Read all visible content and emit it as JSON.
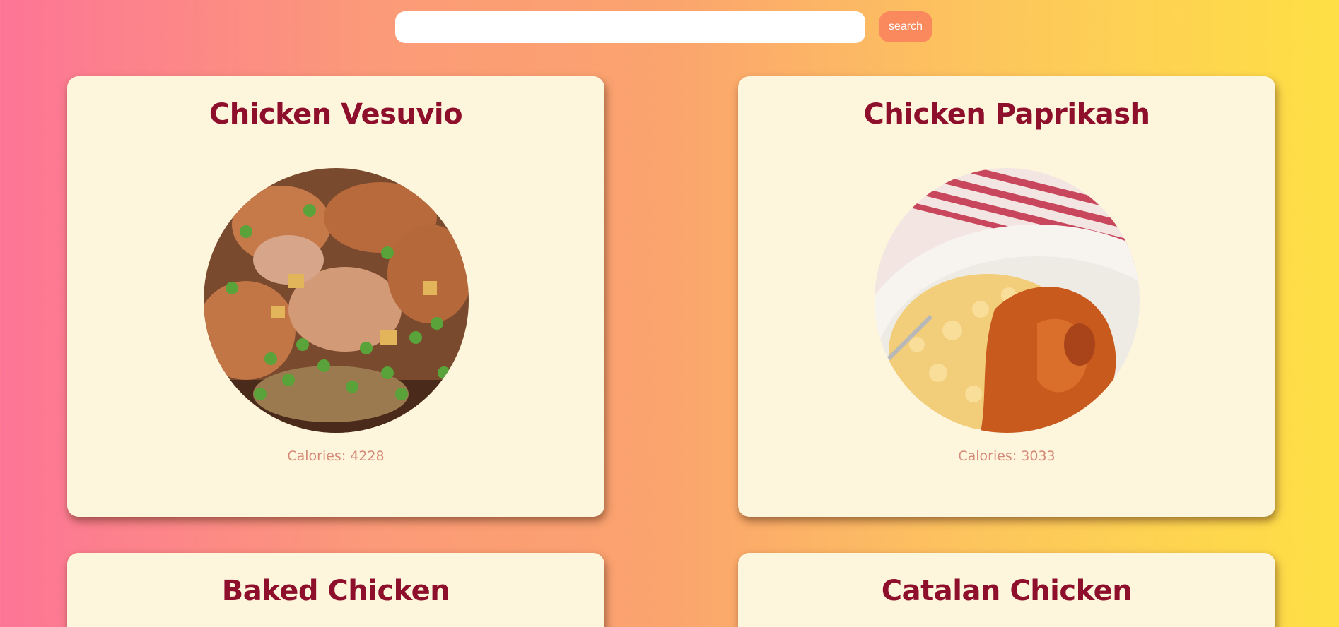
{
  "search": {
    "value": "",
    "placeholder": "",
    "button_label": "search"
  },
  "colors": {
    "gradient_start": "#fd7596",
    "gradient_end": "#fee045",
    "card_background": "#fef6dc",
    "title_color": "#8e0f2c",
    "calories_color": "#d58a78",
    "button_color": "#fa8a5d"
  },
  "recipes": [
    {
      "title": "Chicken Vesuvio",
      "calories": "Calories: 4228",
      "image": "chicken-vesuvio-photo"
    },
    {
      "title": "Chicken Paprikash",
      "calories": "Calories: 3033",
      "image": "chicken-paprikash-photo"
    },
    {
      "title": "Baked Chicken"
    },
    {
      "title": "Catalan Chicken"
    }
  ]
}
